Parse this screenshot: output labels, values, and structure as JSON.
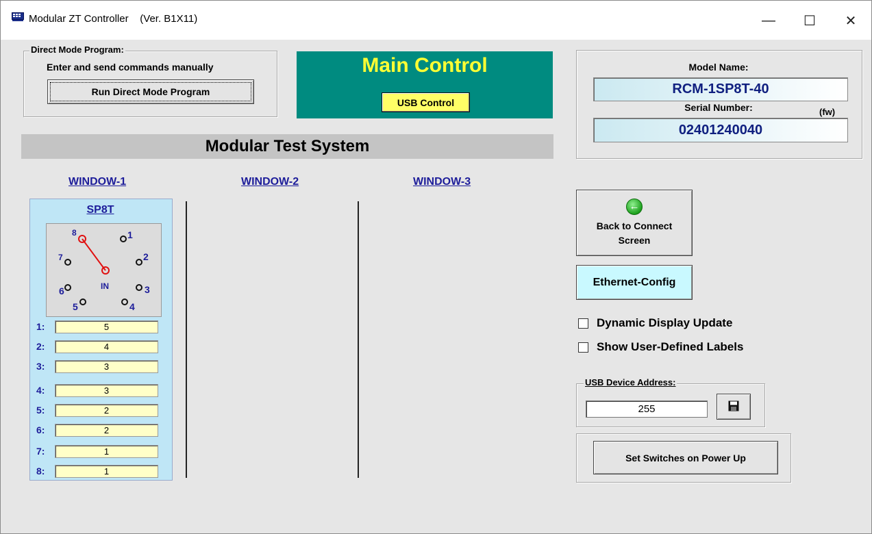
{
  "window": {
    "title": "Modular ZT Controller",
    "version": "(Ver. B1X11)",
    "minimize_glyph": "—",
    "maximize_glyph": "☐",
    "close_glyph": "✕"
  },
  "direct_mode": {
    "legend": "Direct Mode Program:",
    "description": "Enter and send commands manually",
    "button_label": "Run Direct Mode Program"
  },
  "main_control": {
    "title": "Main Control",
    "usb_button": "USB Control",
    "accent_color": "#008b80"
  },
  "device": {
    "model_label": "Model Name:",
    "model_name": "RCM-1SP8T-40",
    "serial_label": "Serial Number:",
    "fw_label": "(fw)",
    "serial_number": "02401240040"
  },
  "system": {
    "banner": "Modular Test System",
    "windows": [
      "WINDOW-1",
      "WINDOW-2",
      "WINDOW-3"
    ]
  },
  "sp8t": {
    "title": "SP8T",
    "common_label": "IN",
    "active_port": 8,
    "ports": [
      "1",
      "2",
      "3",
      "4",
      "5",
      "6",
      "7",
      "8"
    ],
    "positions": [
      {
        "label": "1:",
        "value": "5"
      },
      {
        "label": "2:",
        "value": "4"
      },
      {
        "label": "3:",
        "value": "3"
      },
      {
        "label": "4:",
        "value": "3"
      },
      {
        "label": "5:",
        "value": "2"
      },
      {
        "label": "6:",
        "value": "2"
      },
      {
        "label": "7:",
        "value": "1"
      },
      {
        "label": "8:",
        "value": "1"
      }
    ]
  },
  "side": {
    "back_button": "Back to Connect Screen",
    "ethernet_button": "Ethernet-Config",
    "dynamic_update": {
      "label": "Dynamic Display Update",
      "checked": false
    },
    "user_labels": {
      "label": "Show User-Defined Labels",
      "checked": false
    },
    "usb_address_legend": "USB Device Address:",
    "usb_address_value": "255",
    "power_button": "Set Switches on Power Up"
  },
  "icons": {
    "app": "app-monitor-icon",
    "back": "back-arrow-icon",
    "save": "floppy-disk-icon"
  }
}
